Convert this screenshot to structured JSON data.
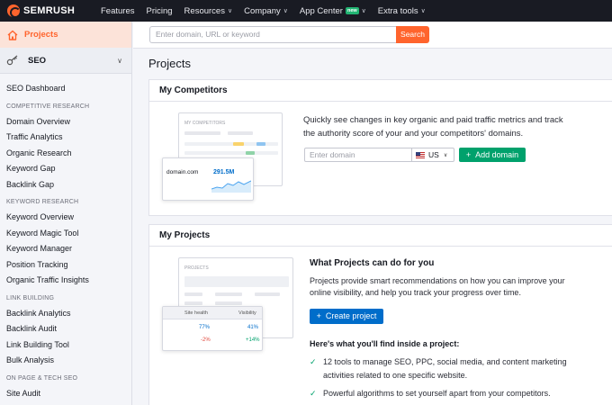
{
  "topbar": {
    "logo": "SEMRUSH",
    "nav": [
      {
        "label": "Features",
        "chevron": false
      },
      {
        "label": "Pricing",
        "chevron": false
      },
      {
        "label": "Resources",
        "chevron": true
      },
      {
        "label": "Company",
        "chevron": true
      },
      {
        "label": "App Center",
        "chevron": true,
        "badge": "new"
      },
      {
        "label": "Extra tools",
        "chevron": true
      }
    ]
  },
  "sidebar": {
    "projects_label": "Projects",
    "seo_label": "SEO",
    "dashboard": "SEO Dashboard",
    "sections": [
      {
        "heading": "COMPETITIVE RESEARCH",
        "items": [
          "Domain Overview",
          "Traffic Analytics",
          "Organic Research",
          "Keyword Gap",
          "Backlink Gap"
        ]
      },
      {
        "heading": "KEYWORD RESEARCH",
        "items": [
          "Keyword Overview",
          "Keyword Magic Tool",
          "Keyword Manager",
          "Position Tracking",
          "Organic Traffic Insights"
        ]
      },
      {
        "heading": "LINK BUILDING",
        "items": [
          "Backlink Analytics",
          "Backlink Audit",
          "Link Building Tool",
          "Bulk Analysis"
        ]
      },
      {
        "heading": "ON PAGE & TECH SEO",
        "items": [
          "Site Audit"
        ]
      }
    ]
  },
  "search": {
    "placeholder": "Enter domain, URL or keyword",
    "button": "Search"
  },
  "page_title": "Projects",
  "competitors": {
    "title": "My Competitors",
    "description": "Quickly see changes in key organic and paid traffic metrics and track the authority score of your and your competitors' domains.",
    "domain_placeholder": "Enter domain",
    "country": "US",
    "add_button": "Add domain",
    "illus_heading": "MY COMPETITORS",
    "illus_domain": "domain.com",
    "illus_value": "291.5M"
  },
  "projects": {
    "title": "My Projects",
    "subtitle": "What Projects can do for you",
    "description": "Projects provide smart recommendations on how you can improve your online visibility, and help you track your progress over time.",
    "create_button": "Create project",
    "inside_title": "Here's what you'll find inside a project:",
    "features": [
      "12 tools to manage SEO, PPC, social media, and content marketing activities related to one specific website.",
      "Powerful algorithms to set yourself apart from your competitors."
    ],
    "illus_heading": "PROJECTS",
    "illus_col1": "Site health",
    "illus_col2": "Visibility",
    "illus_row1": [
      "77%",
      "41%"
    ],
    "illus_row2": [
      "-2%",
      "+14%"
    ]
  },
  "colors": {
    "brand_orange": "#ff642d",
    "topbar": "#191b23",
    "green": "#00a16c",
    "blue": "#006dca"
  }
}
